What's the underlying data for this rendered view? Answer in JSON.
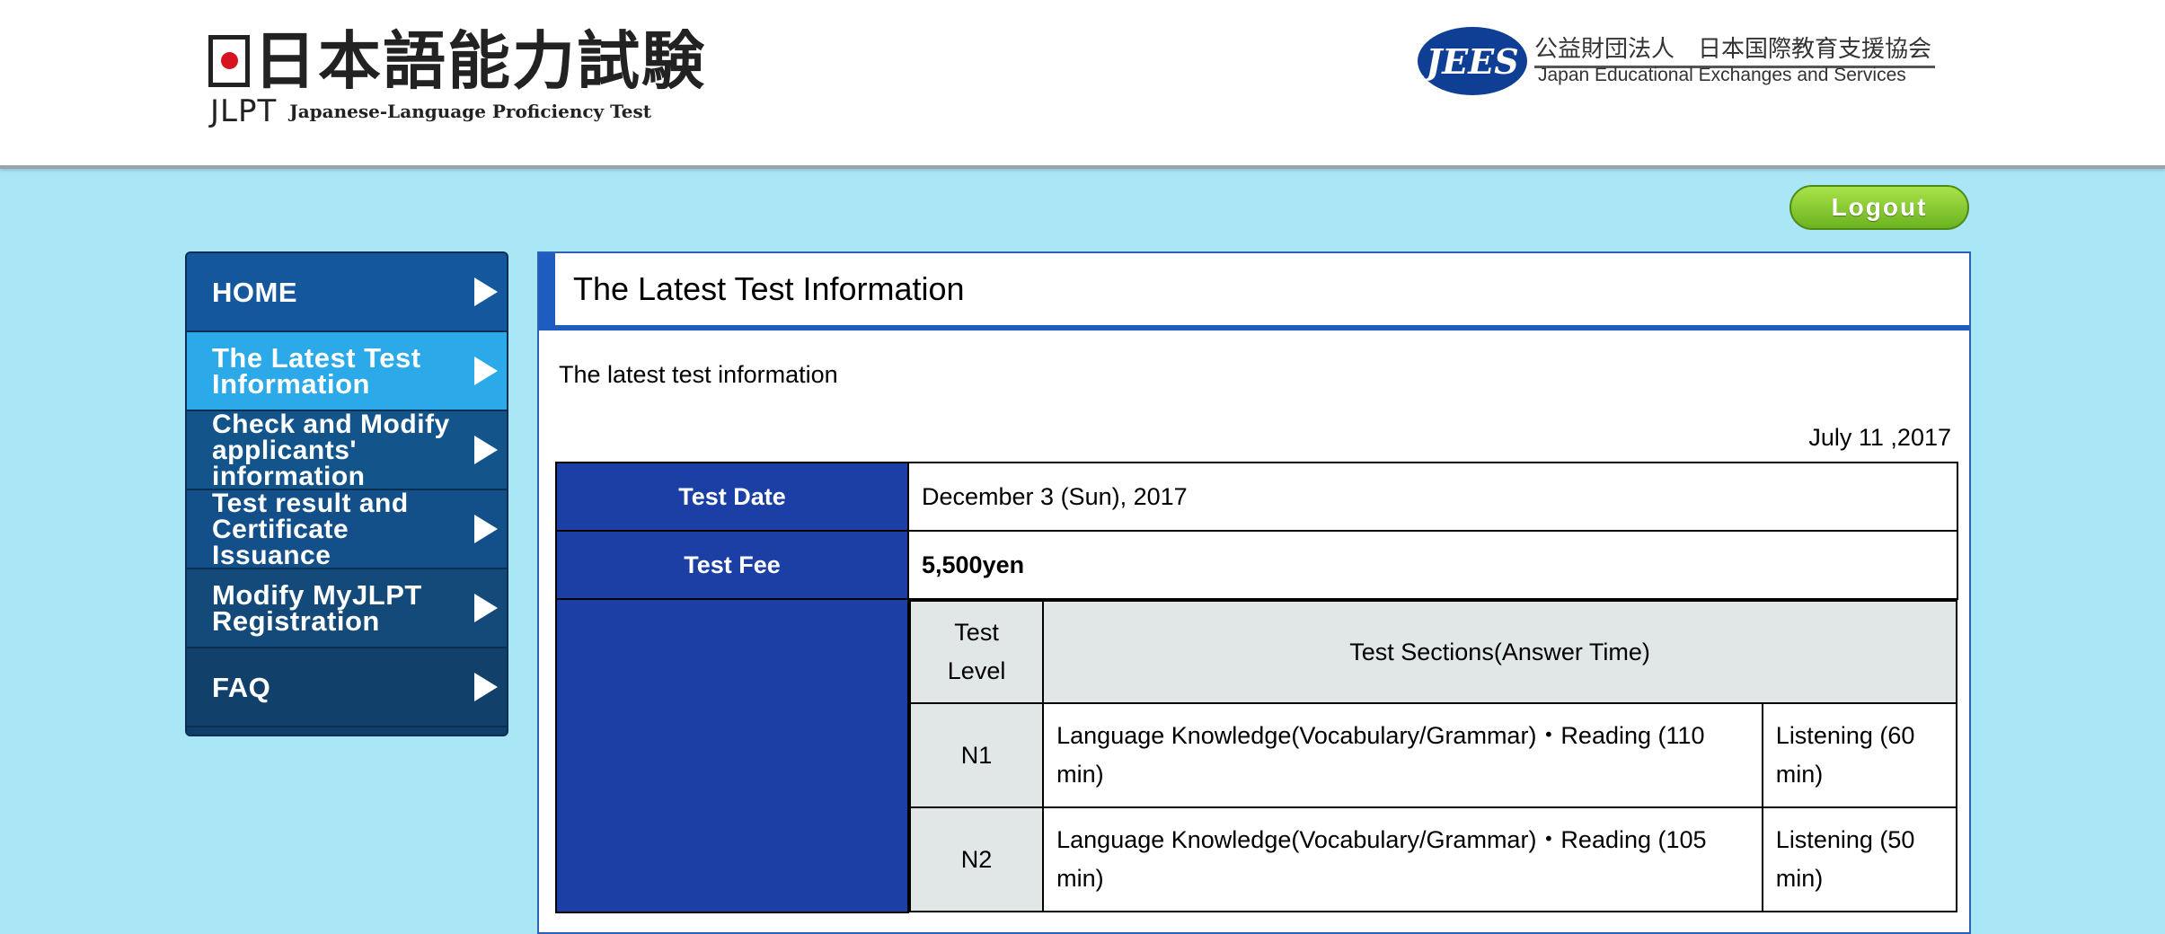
{
  "header": {
    "title_jp": "日本語能力試験",
    "logo_short": "JLPT",
    "logo_en": "Japanese-Language Proficiency Test",
    "org_badge": "JEES",
    "org_jp": "公益財団法人　日本国際教育支援協会",
    "org_en": "Japan Educational Exchanges and Services"
  },
  "logout_label": "Logout",
  "sidebar": {
    "items": [
      {
        "label": "HOME"
      },
      {
        "label": "The Latest Test Information"
      },
      {
        "label": "Check and Modify applicants' information"
      },
      {
        "label": "Test result and Certificate Issuance"
      },
      {
        "label": "Modify MyJLPT Registration"
      },
      {
        "label": "FAQ"
      }
    ]
  },
  "main": {
    "title": "The Latest Test Information",
    "intro": "The latest test information",
    "date": "July 11 ,2017",
    "rows": {
      "date_label": "Test Date",
      "date_value": "December 3 (Sun), 2017",
      "fee_label": "Test Fee",
      "fee_value": "5,500yen"
    },
    "sections": {
      "level_header": "Test Level",
      "sections_header": "Test Sections(Answer Time)",
      "levels": [
        {
          "level": "N1",
          "part1": "Language Knowledge(Vocabulary/Grammar)・Reading (110 min)",
          "part2": "Listening (60 min)"
        },
        {
          "level": "N2",
          "part1": "Language Knowledge(Vocabulary/Grammar)・Reading (105 min)",
          "part2": "Listening (50 min)"
        }
      ]
    }
  },
  "colors": {
    "page_bg": "#a9e6f6",
    "label_bg": "#1c3fa6",
    "nav_active": "#2ba9e8",
    "accent": "#1e5cc0"
  }
}
